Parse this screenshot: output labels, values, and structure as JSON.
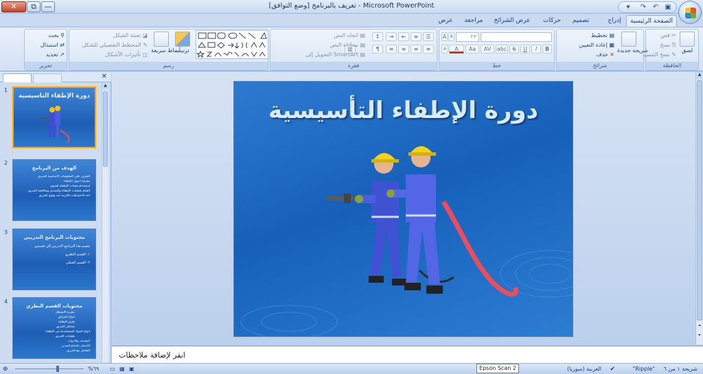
{
  "window": {
    "title": "تعريف بالبرنامج [وضع التوافق] - Microsoft PowerPoint",
    "close": "✕",
    "restore": "⧉",
    "minimize": "—"
  },
  "tabs": [
    "الصفحة الرئيسية",
    "إدراج",
    "تصميم",
    "حركات",
    "عرض الشرائح",
    "مراجعة",
    "عرض"
  ],
  "ribbon": {
    "clipboard": {
      "label": "الحافظة",
      "paste": "لصق",
      "cut": "قص",
      "copy": "نسخ",
      "format_painter": "نسخ التنسيق"
    },
    "slides": {
      "label": "شرائح",
      "new_slide": "شريحة جديدة",
      "layout": "تخطيط",
      "reset": "إعادة التعيين",
      "delete": "حذف"
    },
    "font": {
      "label": "خط",
      "size": "٢٣",
      "bold": "B",
      "italic": "I",
      "underline": "U",
      "strike": "S",
      "shadow": "abc",
      "spacing": "AV",
      "case": "Aa",
      "color": "A",
      "grow": "A",
      "shrink": "A",
      "clear": "A"
    },
    "paragraph": {
      "label": "فقرة",
      "text_direction": "اتجاه النص",
      "align_text": "محاذاة النص",
      "smartart": "التحويل إلى SmartArt"
    },
    "drawing": {
      "label": "رسم",
      "arrange": "ترتيب",
      "quick_styles": "أنماط سريعة",
      "shape_fill": "تعبئة الشكل",
      "shape_outline": "المخطط التفصيلي للشكل",
      "shape_effects": "تأثيرات الأشكال"
    },
    "editing": {
      "label": "تحرير",
      "find": "بحث",
      "replace": "استبدال",
      "select": "تحديد"
    }
  },
  "slides": [
    {
      "num": "1",
      "title": "دورة الإطفاء التأسيسية"
    },
    {
      "num": "2",
      "title": "الهدف من البرنامج",
      "lines": [
        "التعرف على المعلومات الأساسية للحريق",
        "معرفة أصول الإطفاء",
        "استخدام معدات الإطفاء اليدوي",
        "القيام بعمليات الإطفاء والتصدي ومكافحة الحريق",
        "أخذ الاحتياطات اللازمة عند وقوع الحريق"
      ]
    },
    {
      "num": "3",
      "title": "محتويات البرنامج التدريبي",
      "lines": [
        "يقسم هذا البرنامج التدريبي إلى قسمين",
        "١- القسم النظري",
        "٢- القسم العملي"
      ]
    },
    {
      "num": "4",
      "title": "محتويات القسم النظري",
      "lines": [
        "نظرية الاشتعال",
        "أنواع الحرائق",
        "طرق الإطفاء",
        "مخاطر الحريق",
        "أنواع المواد المستخدمة في الإطفاء",
        "طفايات الحريق",
        "المعدات والأدوات",
        "الاتصال بالدفاع المدني",
        "التعامل مع الحريق"
      ]
    }
  ],
  "main_slide": {
    "title": "دورة الإطفاء التأسيسية"
  },
  "notes": {
    "placeholder": "انقر لإضافة ملاحظات"
  },
  "status": {
    "slide_info": "شريحة ١ من ٦",
    "theme": "\"Ripple\"",
    "language": "العربية (سوريا)",
    "zoom": "%٦٩",
    "tooltip": "Epson Scan 2"
  },
  "colors": {
    "slide_bg": "#1e66bf",
    "accent": "#15428b",
    "selection": "#e8a43c"
  }
}
